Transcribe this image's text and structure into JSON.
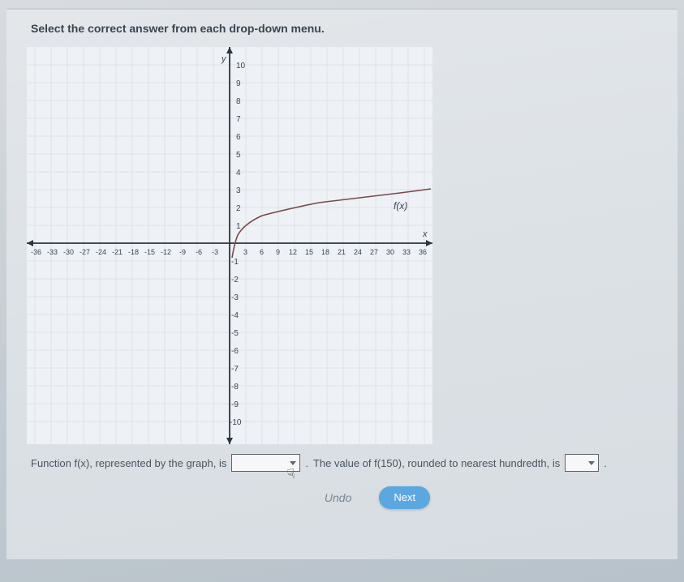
{
  "instruction": "Select the correct answer from each drop-down menu.",
  "answer": {
    "part1_before": "Function f(x), represented by the graph, is",
    "part1_after": ".",
    "part2_before": "The value of f(150), rounded to nearest hundredth, is",
    "part2_after": "."
  },
  "buttons": {
    "undo": "Undo",
    "next": "Next"
  },
  "chart_data": {
    "type": "line",
    "title": "",
    "xlabel": "x",
    "ylabel": "y",
    "xlim": [
      -36,
      36
    ],
    "ylim": [
      -10,
      10
    ],
    "x_ticks": [
      -36,
      -33,
      -30,
      -27,
      -24,
      -21,
      -18,
      -15,
      -12,
      -9,
      -6,
      -3,
      3,
      6,
      9,
      12,
      15,
      18,
      21,
      24,
      27,
      30,
      33,
      36
    ],
    "y_ticks": [
      -10,
      -9,
      -8,
      -7,
      -6,
      -5,
      -4,
      -3,
      -2,
      -1,
      1,
      2,
      3,
      4,
      5,
      6,
      7,
      8,
      9,
      10
    ],
    "series": [
      {
        "name": "f(x)",
        "x": [
          0,
          0.5,
          1,
          2,
          3,
          6,
          9,
          12,
          15,
          18,
          21,
          24,
          27,
          30,
          33,
          36
        ],
        "values": [
          null,
          -0.6,
          0,
          0.6,
          0.95,
          1.55,
          1.9,
          2.15,
          2.34,
          2.5,
          2.63,
          2.75,
          2.85,
          2.94,
          3.02,
          3.1
        ]
      }
    ],
    "annotations": [
      {
        "text": "f(x)",
        "x": 33,
        "y": 2.5
      }
    ]
  }
}
